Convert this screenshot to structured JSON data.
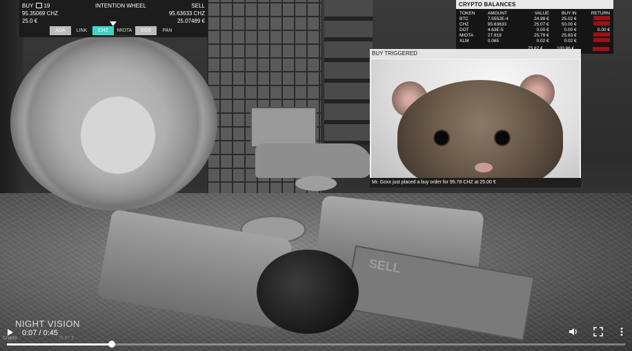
{
  "overlay": {
    "buy_label": "BUY",
    "lock_count": "19",
    "wheel_title": "INTENTION WHEEL",
    "sell_label": "SELL",
    "buy_amount": "95.35069 CHZ",
    "sell_amount": "95.63633 CHZ",
    "buy_value": "25.0 €",
    "sell_value": "25.07489 €",
    "tabs": [
      "ADA",
      "LINK",
      "CHZ",
      "MIOTA",
      "EOS",
      "PAN"
    ],
    "active_tab": "CHZ"
  },
  "balances": {
    "title": "CRYPTO BALANCES",
    "headers": [
      "TOKEN",
      "AMOUNT",
      "VALUE",
      "BUY IN",
      "RETURN"
    ],
    "rows": [
      {
        "token": "BTC",
        "amount": "7.5552E-4",
        "value": "24.98 €",
        "buy_in": "25.02 €",
        "return": "",
        "return_color": "red"
      },
      {
        "token": "CHZ",
        "amount": "95.63633",
        "value": "25.07 €",
        "buy_in": "50.00 €",
        "return": "",
        "return_color": "red"
      },
      {
        "token": "DOT",
        "amount": "4.63E-5",
        "value": "0.00 €",
        "buy_in": "0.00 €",
        "return": "0.00 €",
        "return_color": "green"
      },
      {
        "token": "MIOTA",
        "amount": "27.919",
        "value": "25.79 €",
        "buy_in": "25.83 €",
        "return": "",
        "return_color": "red"
      },
      {
        "token": "XLM",
        "amount": "0.065",
        "value": "0.02 €",
        "buy_in": "0.02 €",
        "return": "",
        "return_color": "red"
      }
    ],
    "total_value": "75.87 €",
    "total_buy_in": "100.86 €"
  },
  "trigger": {
    "header": "BUY TRIGGERED",
    "caption": "Mr. Goxx just placed a buy order for 95.78 CHZ at 25.00 €"
  },
  "scene": {
    "sell_sign": "SELL",
    "night_vision": "NIGHT VISION"
  },
  "player": {
    "current_time": "0:07",
    "duration": "0:45",
    "time_text": "0:07 / 0:45",
    "progress": 0.17,
    "watermark": "Crypto",
    "bottom_value": "75.87 €"
  }
}
